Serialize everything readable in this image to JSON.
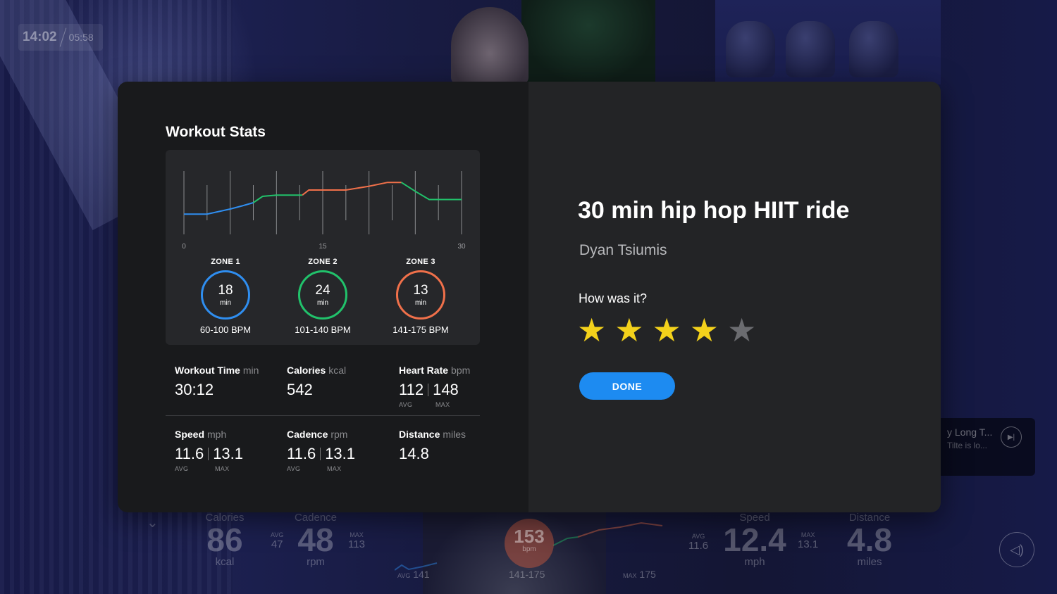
{
  "clock": {
    "time": "14:02",
    "elapsed": "05:58"
  },
  "now_playing": {
    "title": "y Long T...",
    "artist": "Tilte is lo..."
  },
  "bottom_metrics": {
    "calories": {
      "label": "Calories",
      "value": "86",
      "unit": "kcal"
    },
    "cadence": {
      "label": "Cadence",
      "value": "48",
      "unit": "rpm",
      "avg_label": "AVG",
      "avg": "47",
      "max_label": "MAX",
      "max": "113"
    },
    "heart_rate": {
      "value": "153",
      "unit": "bpm",
      "avg_label": "AVG",
      "avg": "141",
      "zone": "141-175",
      "max_label": "MAX",
      "max": "175"
    },
    "speed": {
      "label": "Speed",
      "value": "12.4",
      "unit": "mph",
      "avg_label": "AVG",
      "avg": "11.6",
      "max_label": "MAX",
      "max": "13.1"
    },
    "distance": {
      "label": "Distance",
      "value": "4.8",
      "unit": "miles"
    }
  },
  "workout_stats": {
    "title": "Workout Stats",
    "chart_data": {
      "type": "line",
      "x_ticks": [
        "0",
        "15",
        "30"
      ],
      "xlim": [
        0,
        30
      ],
      "ylim": [
        0,
        1
      ],
      "grid": true,
      "series": [
        {
          "zone": 1,
          "color": "#2f8ef0",
          "x": [
            0,
            2.5,
            5,
            6.3,
            7.5
          ],
          "y": [
            0.32,
            0.32,
            0.4,
            0.45,
            0.5
          ]
        },
        {
          "zone": 2,
          "color": "#21c26b",
          "x": [
            7.5,
            8.5,
            10,
            12.5,
            12.8
          ],
          "y": [
            0.5,
            0.6,
            0.62,
            0.62,
            0.62
          ]
        },
        {
          "zone": 3,
          "color": "#f0704a",
          "x": [
            12.8,
            13.5,
            15,
            17.5,
            20,
            22,
            23.5
          ],
          "y": [
            0.62,
            0.7,
            0.7,
            0.7,
            0.76,
            0.82,
            0.82
          ]
        },
        {
          "zone": 2,
          "color": "#21c26b",
          "x": [
            23.5,
            25,
            26.5,
            28,
            30
          ],
          "y": [
            0.82,
            0.68,
            0.55,
            0.55,
            0.55
          ]
        }
      ]
    },
    "zones": [
      {
        "label": "ZONE 1",
        "minutes": "18",
        "unit": "min",
        "range": "60-100 BPM",
        "color": "#2f8ef0"
      },
      {
        "label": "ZONE 2",
        "minutes": "24",
        "unit": "min",
        "range": "101-140 BPM",
        "color": "#21c26b"
      },
      {
        "label": "ZONE 3",
        "minutes": "13",
        "unit": "min",
        "range": "141-175 BPM",
        "color": "#f0704a"
      }
    ],
    "stats": {
      "workout_time": {
        "label": "Workout Time",
        "unit": "min",
        "value": "30:12"
      },
      "calories": {
        "label": "Calories",
        "unit": "kcal",
        "value": "542"
      },
      "heart_rate": {
        "label": "Heart Rate",
        "unit": "bpm",
        "avg": "112",
        "max": "148",
        "avg_label": "AVG",
        "max_label": "MAX"
      },
      "speed": {
        "label": "Speed",
        "unit": "mph",
        "avg": "11.6",
        "max": "13.1",
        "avg_label": "AVG",
        "max_label": "MAX"
      },
      "cadence": {
        "label": "Cadence",
        "unit": "rpm",
        "avg": "11.6",
        "max": "13.1",
        "avg_label": "AVG",
        "max_label": "MAX"
      },
      "distance": {
        "label": "Distance",
        "unit": "miles",
        "value": "14.8"
      }
    }
  },
  "ride": {
    "title": "30 min hip hop HIIT ride",
    "instructor": "Dyan Tsiumis",
    "rating_prompt": "How was it?",
    "rating": 4,
    "rating_max": 5,
    "done_label": "DONE"
  },
  "colors": {
    "accent": "#1d8bf1",
    "star_on": "#f3d11b",
    "star_off": "#6b6c70"
  }
}
